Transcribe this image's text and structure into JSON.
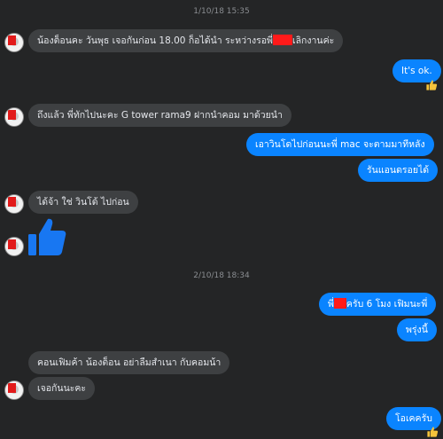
{
  "colors": {
    "background": "#242526",
    "incoming": "#3e4042",
    "outgoing": "#0a84ff",
    "like": "#1877f2",
    "redaction": "#ff1a1a"
  },
  "timestamps": [
    "1/10/18 15:35",
    "2/10/18 18:34"
  ],
  "messages": {
    "m1_before": "น้องต็อนคะ วันพุธ เจอกันก่อน 18.00 ก็อได้นำ ระหว่างรอพี่",
    "m1_after": "เลิกงานค่ะ",
    "m2": "It's ok.",
    "m3": "ถึงแล้ว พี่ทักไปนะคะ G tower rama9 ฝากนำคอม มาด้วยนำ",
    "m4": "เอาวินโดไปก่อนนะพี่ mac จะตามมาทีหลัง",
    "m5": "รันแอนดรอยได้",
    "m6": "ได้จ้า ใช่ วินโด้ ไปก่อน",
    "m7_before": "พี่",
    "m7_after": "ครับ 6 โมง เฟิมนะพี่",
    "m8": "พรุ่งนี้",
    "m9": "คอนเฟิมค้า น้องต็อน อย่าลืมสำเนา กับคอมน้า",
    "m10": "เจอกันนะคะ",
    "m11": "โอเคครับ"
  },
  "icons": [
    "avatar",
    "like-icon",
    "redaction-mark"
  ]
}
